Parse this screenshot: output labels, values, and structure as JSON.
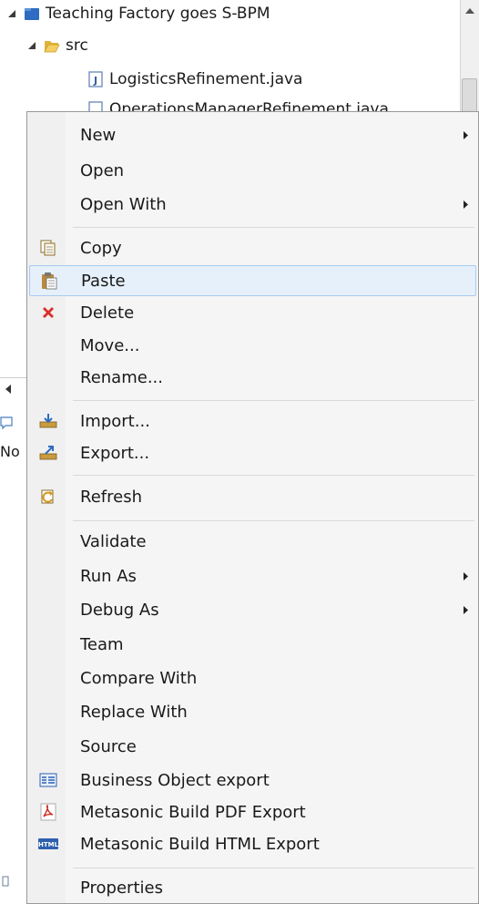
{
  "tree": {
    "project": {
      "label": "Teaching Factory goes S-BPM",
      "icon": "project-folder-icon"
    },
    "src": {
      "label": "src",
      "icon": "open-folder-icon"
    },
    "file1": {
      "label": "LogisticsRefinement.java",
      "icon": "java-file-icon"
    },
    "file2": {
      "label": "OperationsManagerRefinement.java",
      "icon": "java-file-icon"
    }
  },
  "left_fragment": {
    "text": "No"
  },
  "menu": {
    "new": "New",
    "open": "Open",
    "open_with": "Open With",
    "copy": "Copy",
    "paste": "Paste",
    "delete": "Delete",
    "move": "Move...",
    "rename": "Rename...",
    "import": "Import...",
    "export": "Export...",
    "refresh": "Refresh",
    "validate": "Validate",
    "run_as": "Run As",
    "debug_as": "Debug As",
    "team": "Team",
    "compare_with": "Compare With",
    "replace_with": "Replace With",
    "source": "Source",
    "bo_export": "Business Object export",
    "pdf_export": "Metasonic Build PDF Export",
    "html_export": "Metasonic Build HTML Export",
    "properties": "Properties",
    "highlighted_item": "Paste"
  },
  "colors": {
    "highlight_bg": "#e5f0fb",
    "highlight_border": "#a8cbee",
    "delete_red": "#d9302b",
    "pdf_red": "#cc2a1e",
    "html_blue": "#2f5fae"
  }
}
